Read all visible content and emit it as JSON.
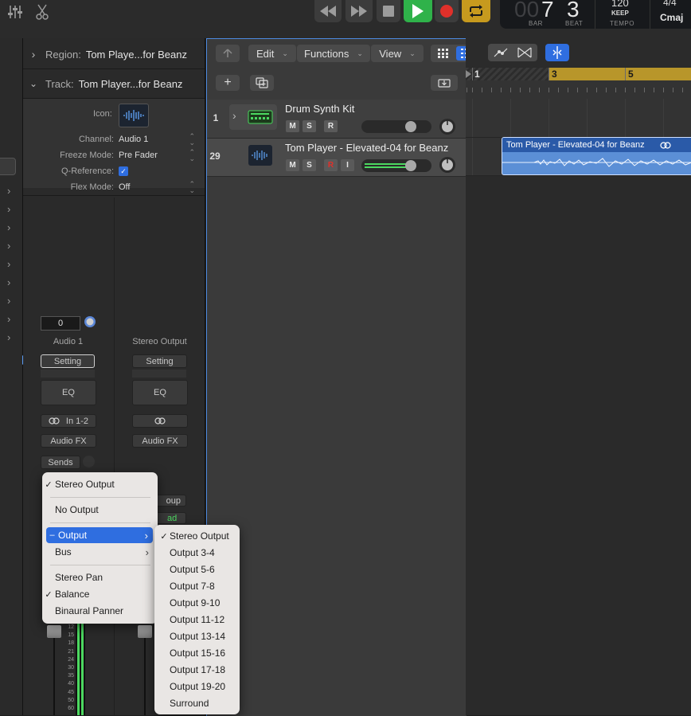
{
  "lcd": {
    "bar_ghost": "00",
    "bar": "7",
    "beat": "3",
    "bar_label": "BAR",
    "beat_label": "BEAT",
    "tempo": "120",
    "tempo_mode": "KEEP",
    "tempo_label": "TEMPO",
    "signature": "4/4",
    "key": "Cmaj"
  },
  "inspector": {
    "region_label": "Region:",
    "region_name": "Tom Playe...for Beanz",
    "track_label": "Track:",
    "track_name": "Tom Player...for Beanz",
    "icon_label": "Icon:",
    "params": [
      {
        "key": "Channel:",
        "value": "Audio 1"
      },
      {
        "key": "Freeze Mode:",
        "value": "Pre Fader"
      },
      {
        "key": "Q-Reference:",
        "value": ""
      },
      {
        "key": "Flex Mode:",
        "value": "Off"
      }
    ],
    "strip1": {
      "value": "0",
      "name": "Audio 1",
      "setting": "Setting",
      "eq": "EQ",
      "input": "In 1-2",
      "audio_fx": "Audio FX",
      "sends": "Sends"
    },
    "strip2": {
      "name": "Stereo Output",
      "setting": "Setting",
      "eq": "EQ",
      "audio_fx": "Audio FX",
      "group_partial": "oup",
      "read_partial": "ad"
    },
    "meter_scale": [
      "12",
      "15",
      "18",
      "21",
      "24",
      "30",
      "35",
      "40",
      "45",
      "50",
      "60"
    ]
  },
  "toolbar": {
    "edit": "Edit",
    "functions": "Functions",
    "view": "View"
  },
  "tracks": [
    {
      "number": "1",
      "name": "Drum Synth Kit",
      "m": "M",
      "s": "S",
      "r": "R"
    },
    {
      "number": "29",
      "name": "Tom Player - Elevated-04 for Beanz",
      "m": "M",
      "s": "S",
      "r": "R",
      "i": "I"
    }
  ],
  "ruler": {
    "bars": [
      "1",
      "3",
      "5"
    ]
  },
  "region": {
    "name": "Tom Player - Elevated-04 for Beanz"
  },
  "output_menu": {
    "items": [
      {
        "label": "Stereo Output",
        "checked": true
      },
      {
        "label": "No Output"
      },
      {
        "label": "Output",
        "selected": true,
        "submenu": true
      },
      {
        "label": "Bus",
        "submenu": true
      },
      {
        "label": "Stereo Pan"
      },
      {
        "label": "Balance",
        "checked": true
      },
      {
        "label": "Binaural Panner"
      }
    ]
  },
  "output_submenu": {
    "items": [
      "Stereo Output",
      "Output 3-4",
      "Output 5-6",
      "Output 7-8",
      "Output 9-10",
      "Output 11-12",
      "Output 13-14",
      "Output 15-16",
      "Output 17-18",
      "Output 19-20",
      "Surround"
    ]
  },
  "colors": {
    "accent": "#2f6ee0",
    "play": "#2fb24a",
    "record": "#e0302a",
    "cycle": "#c79a1e",
    "region": "#5b8fd6",
    "cycle_bar": "#b8962a"
  }
}
